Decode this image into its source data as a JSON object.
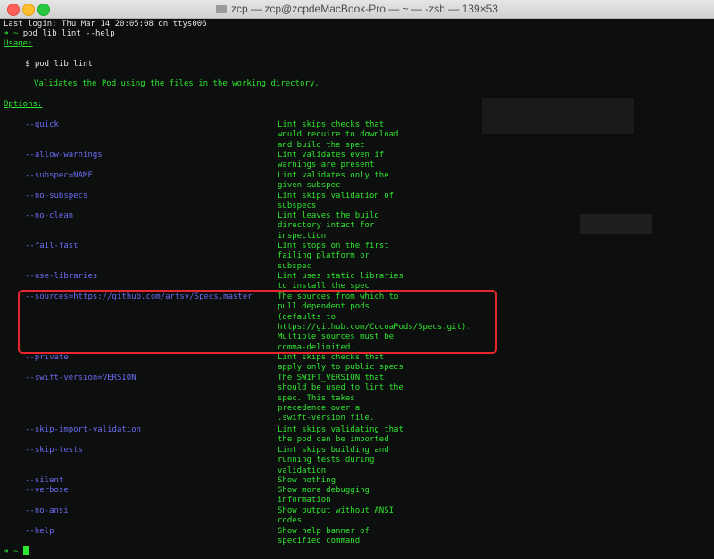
{
  "window": {
    "title": "zcp — zcp@zcpdeMacBook-Pro — ~ — -zsh — 139×53"
  },
  "terminal": {
    "last_login": "Last login: Thu Mar 14 20:05:08 on ttys006",
    "prompt_arrow": "➜",
    "prompt_dir": "~",
    "command": "pod lib lint --help",
    "usage_header": "Usage:",
    "usage_cmd": "$ pod lib lint",
    "usage_desc": "Validates the Pod using the files in the working directory.",
    "options_header": "Options:",
    "options": [
      {
        "flag": "--quick",
        "desc": [
          "Lint skips checks that",
          "would require to download",
          "and build the spec"
        ]
      },
      {
        "flag": "--allow-warnings",
        "desc": [
          "Lint validates even if",
          "warnings are present"
        ]
      },
      {
        "flag": "--subspec=NAME",
        "desc": [
          "Lint validates only the",
          "given subspec"
        ]
      },
      {
        "flag": "--no-subspecs",
        "desc": [
          "Lint skips validation of",
          "subspecs"
        ]
      },
      {
        "flag": "--no-clean",
        "desc": [
          "Lint leaves the build",
          "directory intact for",
          "inspection"
        ]
      },
      {
        "flag": "--fail-fast",
        "desc": [
          "Lint stops on the first",
          "failing platform or",
          "subspec"
        ]
      },
      {
        "flag": "--use-libraries",
        "desc": [
          "Lint uses static libraries",
          "to install the spec"
        ]
      },
      {
        "flag": "--sources=https://github.com/artsy/Specs,master",
        "desc": [
          "The sources from which to",
          "pull dependent pods",
          "(defaults to",
          "https://github.com/CocoaPods/Specs.git).",
          "Multiple sources must be",
          "comma-delimited."
        ]
      },
      {
        "flag": "--private",
        "desc": [
          "Lint skips checks that",
          "apply only to public specs"
        ]
      },
      {
        "flag": "--swift-version=VERSION",
        "desc": [
          "The SWIFT_VERSION that",
          "should be used to lint the",
          "spec. This takes",
          "precedence over a",
          ".swift-version file."
        ]
      },
      {
        "flag": "--skip-import-validation",
        "desc": [
          "Lint skips validating that",
          "the pod can be imported"
        ]
      },
      {
        "flag": "--skip-tests",
        "desc": [
          "Lint skips building and",
          "running tests during",
          "validation"
        ]
      },
      {
        "flag": "--silent",
        "desc": [
          "Show nothing"
        ]
      },
      {
        "flag": "--verbose",
        "desc": [
          "Show more debugging",
          "information"
        ]
      },
      {
        "flag": "--no-ansi",
        "desc": [
          "Show output without ANSI",
          "codes"
        ]
      },
      {
        "flag": "--help",
        "desc": [
          "Show help banner of",
          "specified command"
        ]
      }
    ],
    "final_prompt_arrow": "➜",
    "final_prompt_dir": "~"
  },
  "colors": {
    "prompt_green": "#2fe62f",
    "flag_blue": "#6b6bf0",
    "highlight_red": "#e8262d"
  },
  "icons": [
    "folder-icon",
    "close-light-icon",
    "minimize-light-icon",
    "zoom-light-icon"
  ]
}
